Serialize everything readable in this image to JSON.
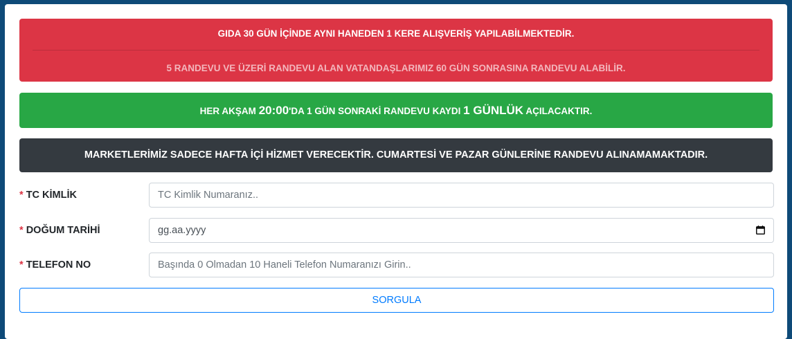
{
  "alerts": {
    "red_line1": "GIDA 30 GÜN İÇİNDE AYNI HANEDEN 1 KERE ALIŞVERİŞ YAPILABİLMEKTEDİR.",
    "red_line2": "5 RANDEVU VE ÜZERİ RANDEVU ALAN VATANDAŞLARIMIZ 60 GÜN SONRASINA RANDEVU ALABİLİR.",
    "green_part1": "HER AKŞAM ",
    "green_time": "20:00",
    "green_part2": "'DA 1 GÜN SONRAKİ RANDEVU KAYDI ",
    "green_days": "1 GÜNLÜK",
    "green_part3": " AÇILACAKTIR.",
    "dark": "MARKETLERİMİZ SADECE HAFTA İÇİ HİZMET VERECEKTİR. CUMARTESİ VE PAZAR GÜNLERİNE RANDEVU ALINAMAMAKTADIR."
  },
  "form": {
    "required_mark": "*",
    "tc": {
      "label": "TC KİMLİK",
      "placeholder": "TC Kimlik Numaranız.."
    },
    "birth": {
      "label": "DOĞUM TARİHİ",
      "placeholder": "gg.aa.yyyy"
    },
    "phone": {
      "label": "TELEFON NO",
      "placeholder": "Başında 0 Olmadan 10 Haneli Telefon Numaranızı Girin.."
    },
    "submit_label": "SORGULA"
  },
  "icons": {
    "calendar": "calendar-icon"
  },
  "colors": {
    "danger": "#dc3545",
    "success": "#28a745",
    "dark": "#343a40",
    "primary": "#007bff",
    "background": "#0e4a78"
  }
}
